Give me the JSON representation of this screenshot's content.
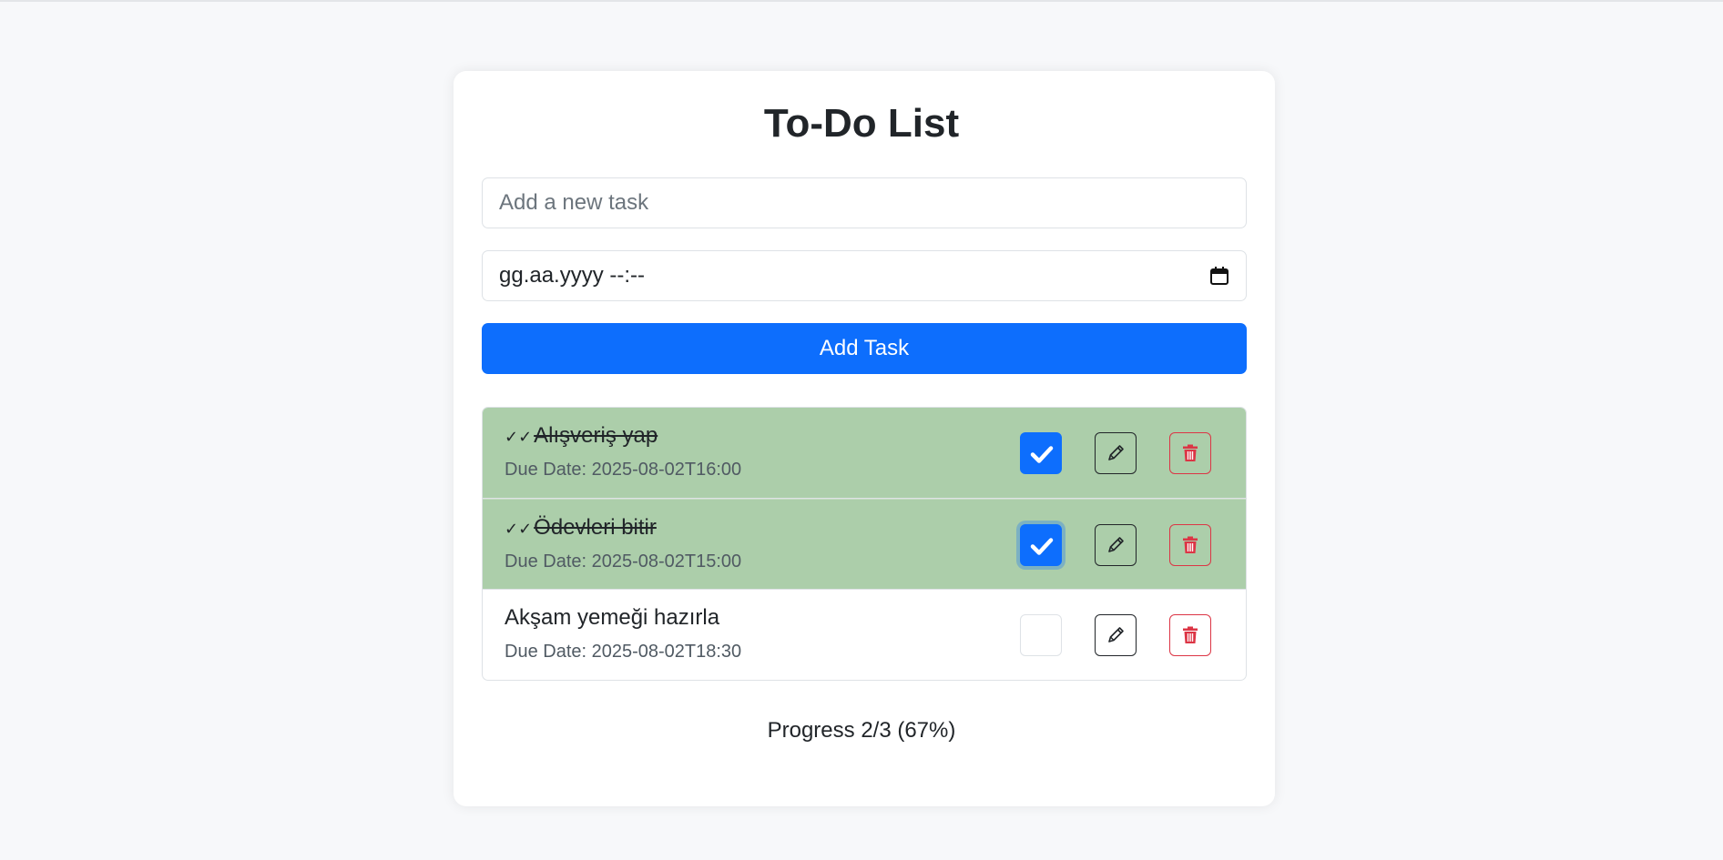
{
  "app": {
    "title": "To-Do List"
  },
  "form": {
    "task_placeholder": "Add a new task",
    "task_value": "",
    "date_display": "gg.aa.yyyy --:--",
    "add_button_label": "Add Task"
  },
  "tasks": [
    {
      "done_mark": "✓✓",
      "name": "Alışveriş yap",
      "due": "Due Date: 2025-08-02T16:00",
      "completed": true
    },
    {
      "done_mark": "✓✓",
      "name": "Ödevleri bitir",
      "due": "Due Date: 2025-08-02T15:00",
      "completed": true
    },
    {
      "done_mark": "",
      "name": "Akşam yemeği hazırla",
      "due": "Due Date: 2025-08-02T18:30",
      "completed": false
    }
  ],
  "progress": {
    "text": "Progress 2/3 (67%)",
    "completed": 2,
    "total": 3
  },
  "colors": {
    "accent": "#0d6efd",
    "completed_row": "#acceaa",
    "danger": "#dc3545"
  },
  "icons": {
    "calendar": "calendar-icon",
    "check": "check-icon",
    "edit": "pencil-icon",
    "delete": "trash-icon"
  }
}
